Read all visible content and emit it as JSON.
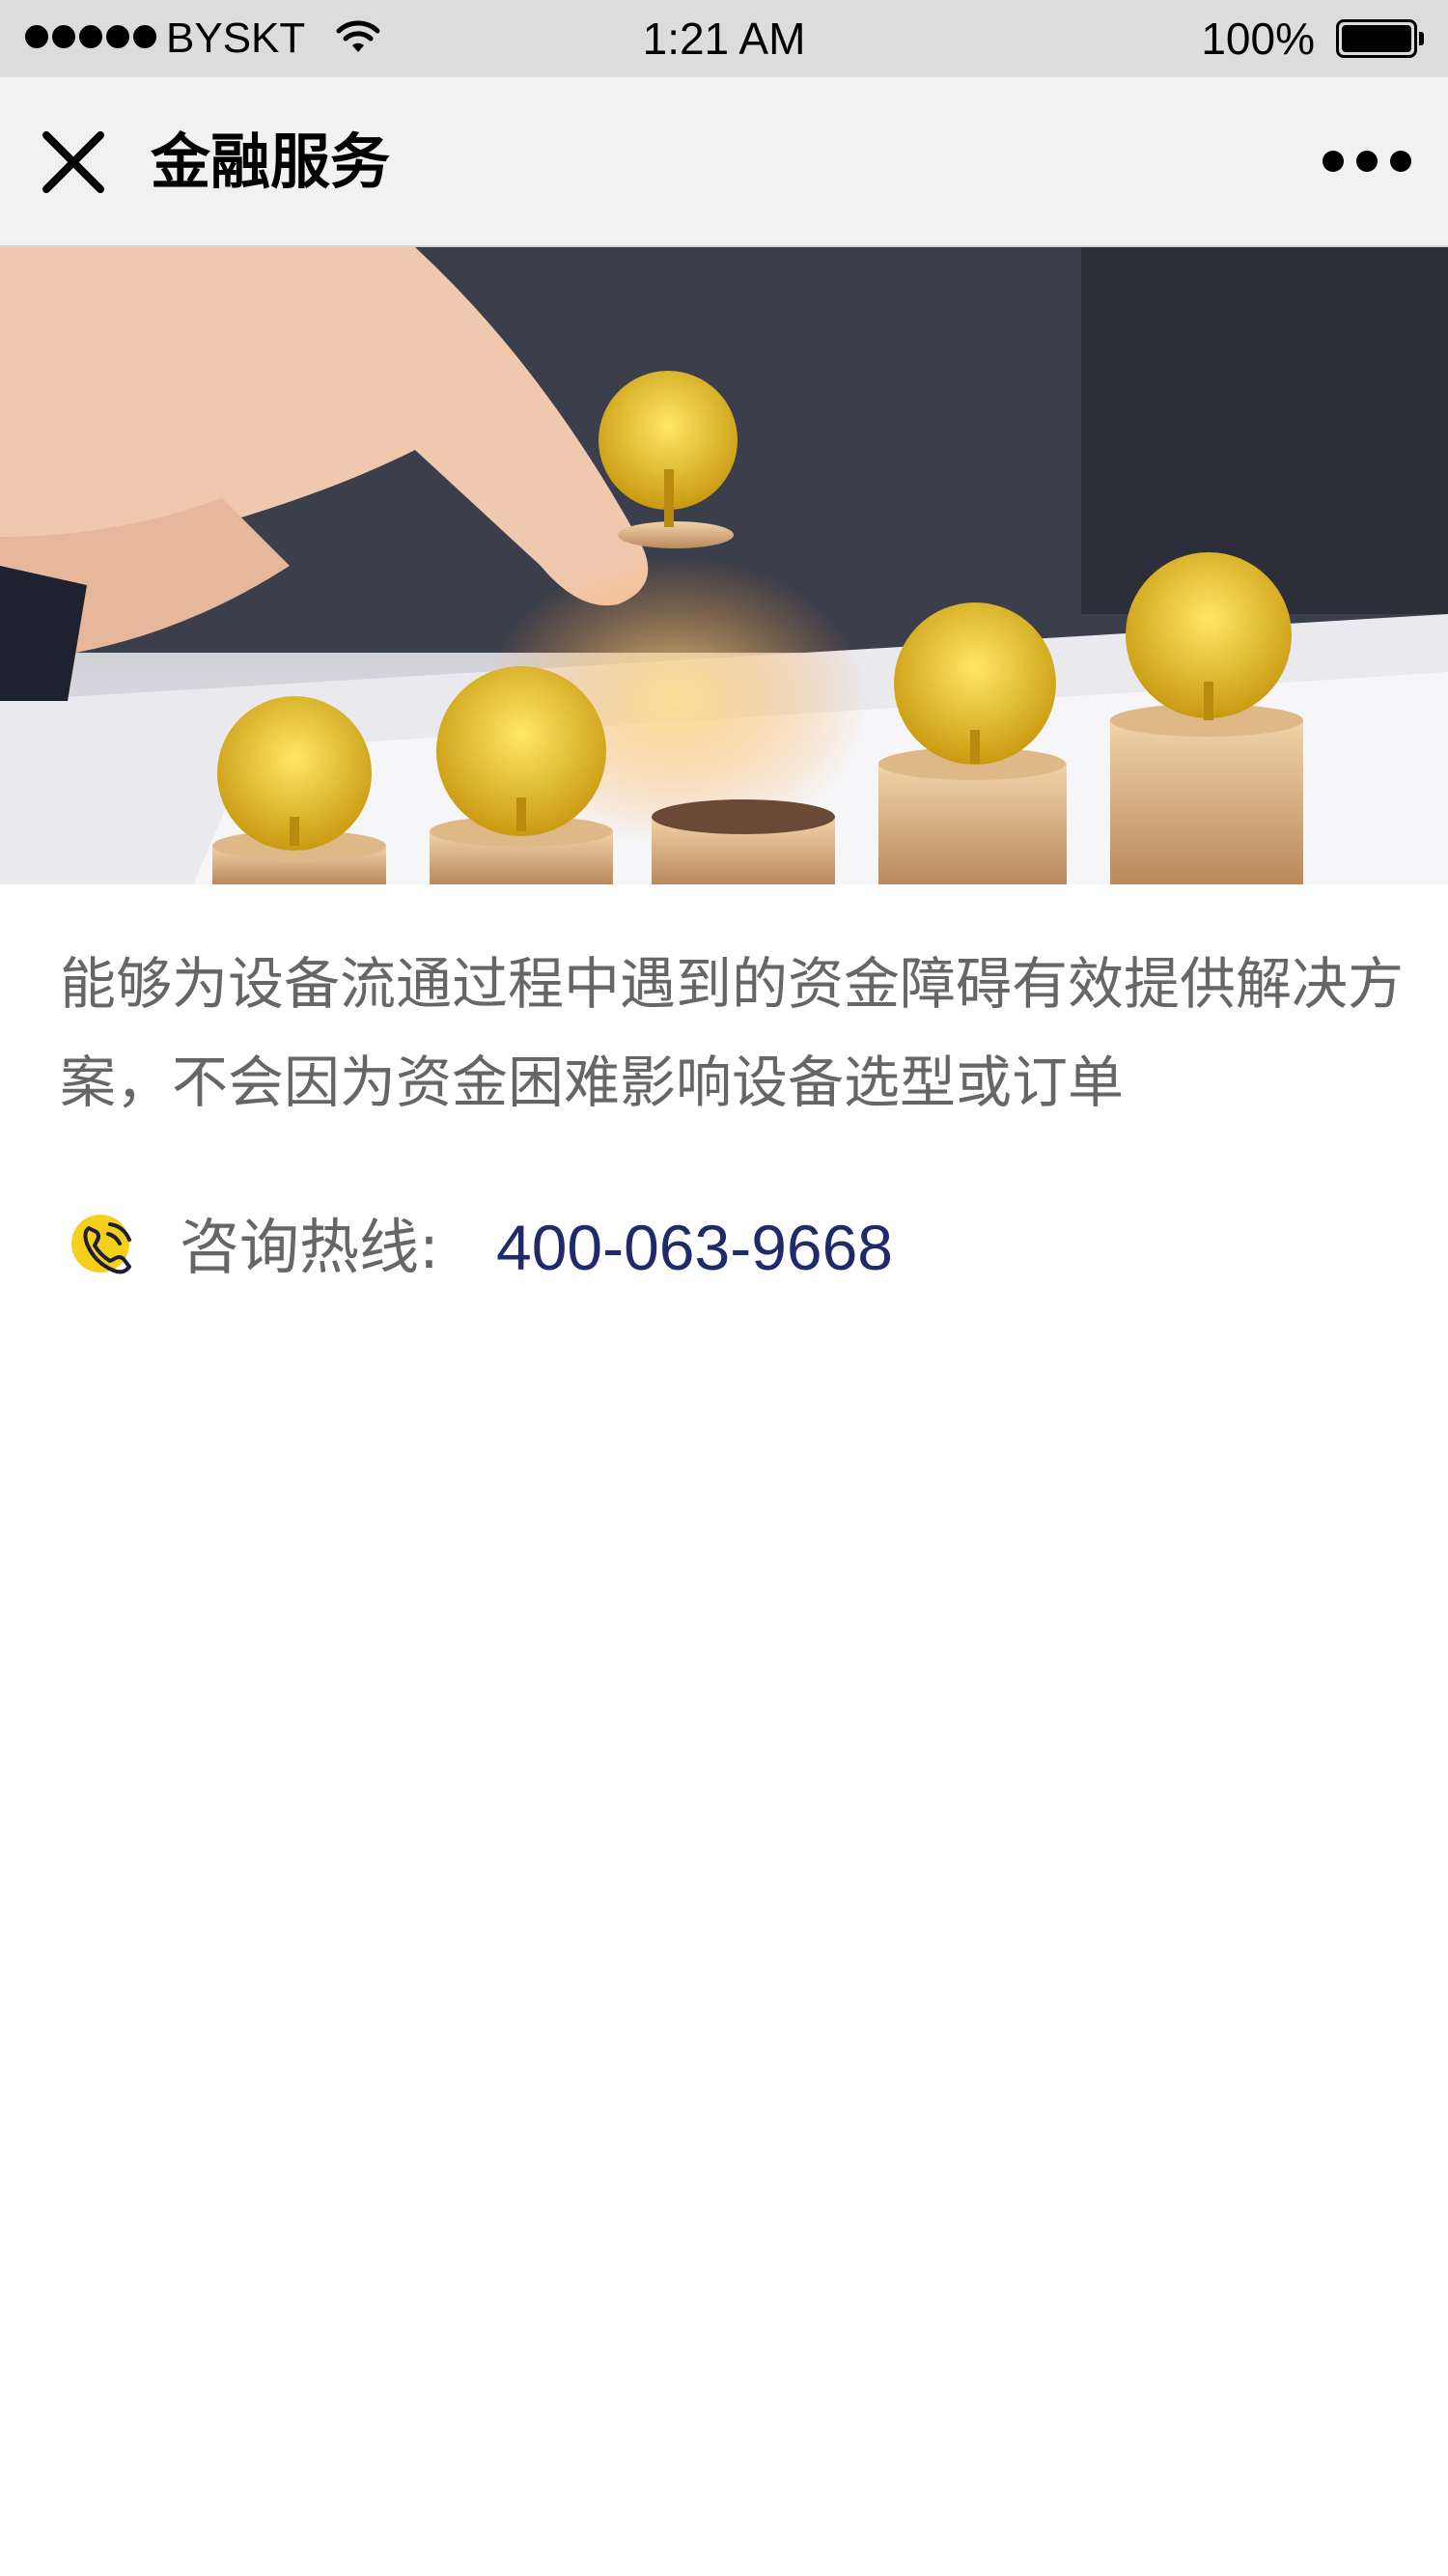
{
  "status_bar": {
    "carrier": "BYSKT",
    "time": "1:21 AM",
    "battery_percent": "100%",
    "signal_bars": 5,
    "battery_level": 1.0
  },
  "nav": {
    "title": "金融服务",
    "close_icon": "close-icon",
    "more_icon": "more-dots-icon"
  },
  "content": {
    "description": "能够为设备流通过程中遇到的资金障碍有效提供解决方案，不会因为资金困难影响设备选型或订单",
    "hotline_label": "咨询热线:",
    "hotline_number": "400-063-9668",
    "phone_icon": "phone-icon"
  },
  "colors": {
    "status_bar_bg": "#dcdcdc",
    "nav_bg": "#f1f1f1",
    "text_gray": "#666666",
    "hotline_blue": "#1f2a6b",
    "icon_yellow": "#f6cf1c"
  }
}
